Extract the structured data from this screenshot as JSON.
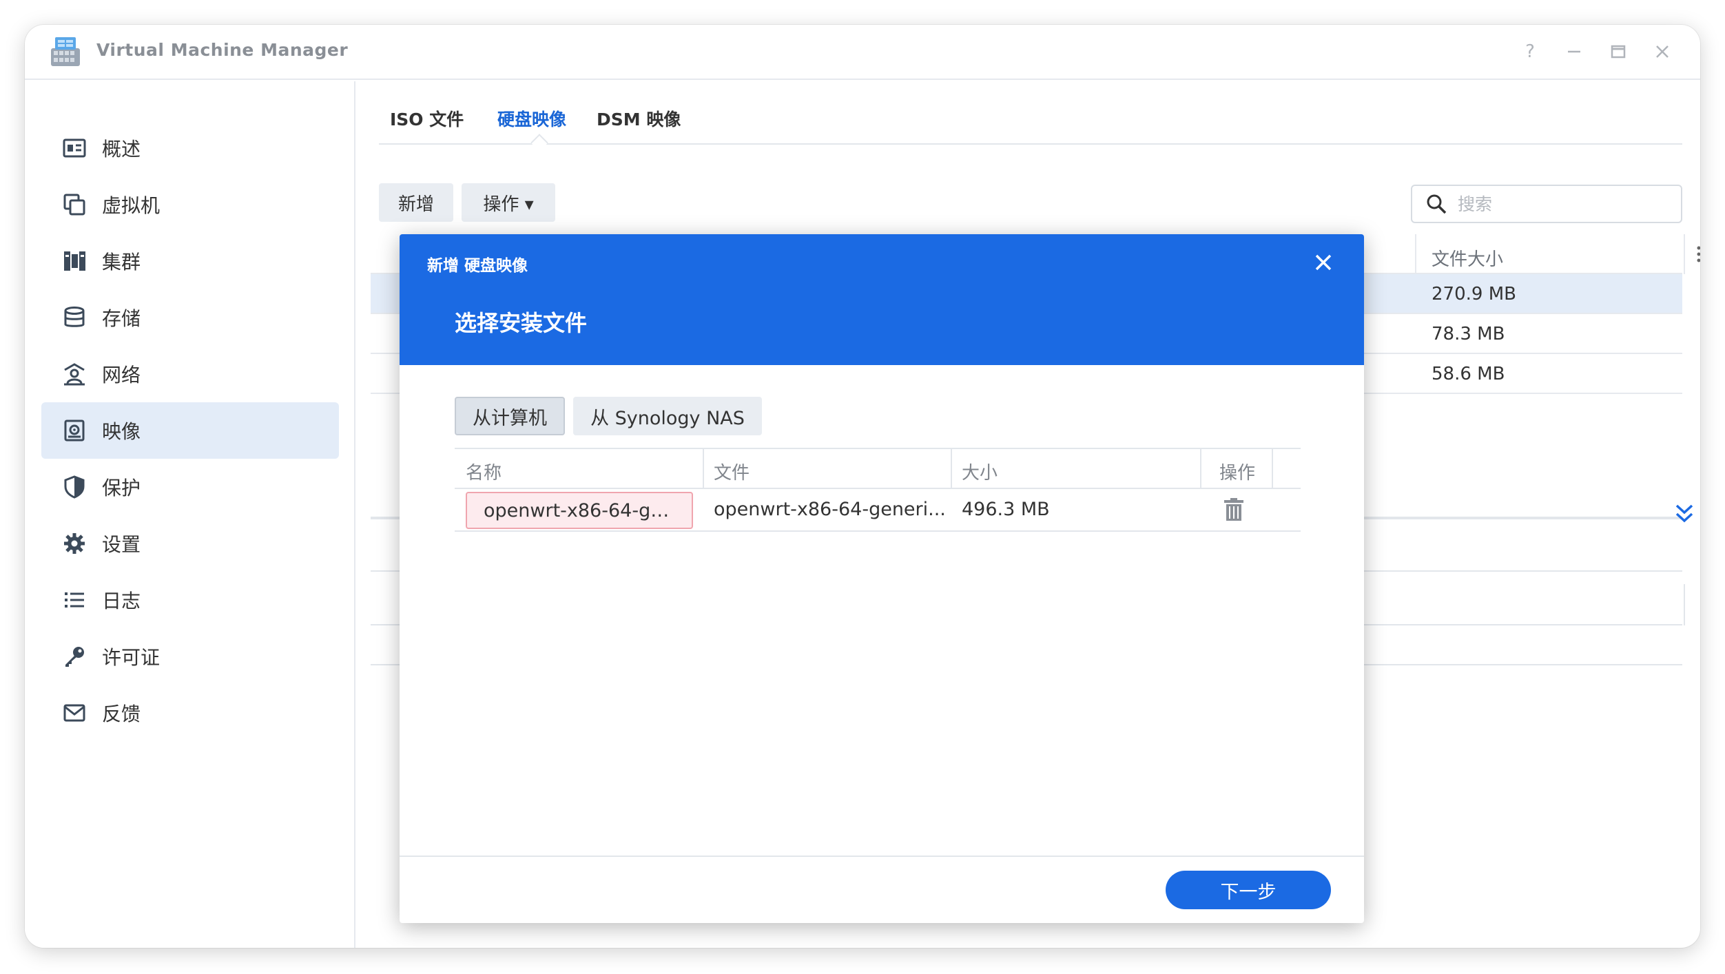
{
  "window": {
    "title": "Virtual Machine Manager"
  },
  "sidebar": {
    "items": [
      {
        "label": "概述",
        "icon": "overview-icon"
      },
      {
        "label": "虚拟机",
        "icon": "vm-icon"
      },
      {
        "label": "集群",
        "icon": "cluster-icon"
      },
      {
        "label": "存储",
        "icon": "storage-icon"
      },
      {
        "label": "网络",
        "icon": "network-icon"
      },
      {
        "label": "映像",
        "icon": "image-icon",
        "active": true
      },
      {
        "label": "保护",
        "icon": "shield-icon"
      },
      {
        "label": "设置",
        "icon": "gear-icon"
      },
      {
        "label": "日志",
        "icon": "list-icon"
      },
      {
        "label": "许可证",
        "icon": "key-icon"
      },
      {
        "label": "反馈",
        "icon": "mail-icon"
      }
    ]
  },
  "tabs": [
    {
      "label": "ISO 文件"
    },
    {
      "label": "硬盘映像",
      "active": true
    },
    {
      "label": "DSM 映像"
    }
  ],
  "toolbar": {
    "add_label": "新增",
    "action_label": "操作 ▾"
  },
  "search": {
    "placeholder": "搜索"
  },
  "background_table": {
    "size_header": "文件大小",
    "rows": [
      {
        "size": "270.9 MB"
      },
      {
        "size": "78.3 MB"
      },
      {
        "size": "58.6 MB"
      }
    ]
  },
  "modal": {
    "title": "新增 硬盘映像",
    "subtitle": "选择安装文件",
    "source_buttons": {
      "computer": "从计算机",
      "nas": "从 Synology NAS"
    },
    "table": {
      "headers": {
        "name": "名称",
        "file": "文件",
        "size": "大小",
        "action": "操作"
      },
      "rows": [
        {
          "name": "openwrt-x86-64-ge...",
          "file": "openwrt-x86-64-generi...",
          "size": "496.3 MB"
        }
      ]
    },
    "next_label": "下一步"
  },
  "colors": {
    "accent": "#1b6ae3",
    "active_nav": "#e3ecf8",
    "invalid_bg": "#fdebee"
  }
}
